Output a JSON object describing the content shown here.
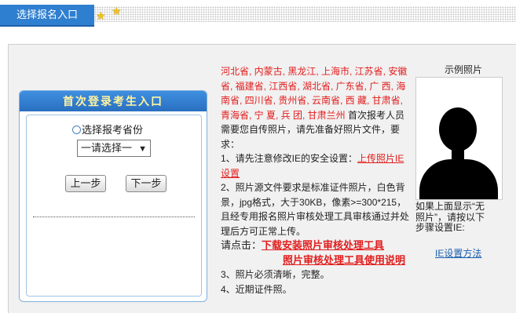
{
  "header": {
    "entry_tab": "选择报名入口"
  },
  "login": {
    "title": "首次登录考生入口",
    "radio_label": "选择报考省份",
    "select_value": "一请选择一",
    "prev_button": "上一步",
    "next_button": "下一步"
  },
  "info": {
    "provinces": "河北省, 内蒙古, 黑龙江, 上海市, 江苏省, 安徽省, 福建省, 江西省, 湖北省, 广东省, 广 西, 海南省, 四川省, 贵州省, 云南省, 西 藏, 甘肃省, 青海省, 宁 夏, 兵 团, 甘肃兰州",
    "intro": " 首次报考人员需要您自传照片，请先准备好照片文件，要求：",
    "item1_prefix": "1、请先注意修改IE的安全设置：",
    "item1_link": "上传照片IE设置",
    "item2": "2、照片源文件要求是标准证件照片，白色背景，jpg格式，大于30KB，像素>=300*215，且经专用报名照片审核处理工具审核通过并处理后方可正常上传。",
    "click_label": "请点击：",
    "download_link": "下载安装照片审核处理工具",
    "manual_link": "照片审核处理工具使用说明",
    "item3": "3、照片必须清晰，完整。",
    "item4": "4、近期证件照。"
  },
  "photo": {
    "title": "示例照片",
    "note": "如果上面显示“无照片”，请按以下步骤设置IE:",
    "ie_link": "IE设置方法"
  },
  "colors": {
    "accent_blue": "#2f7fd0",
    "province_red": "#e21d1d",
    "link_blue": "#1a5fb0"
  }
}
